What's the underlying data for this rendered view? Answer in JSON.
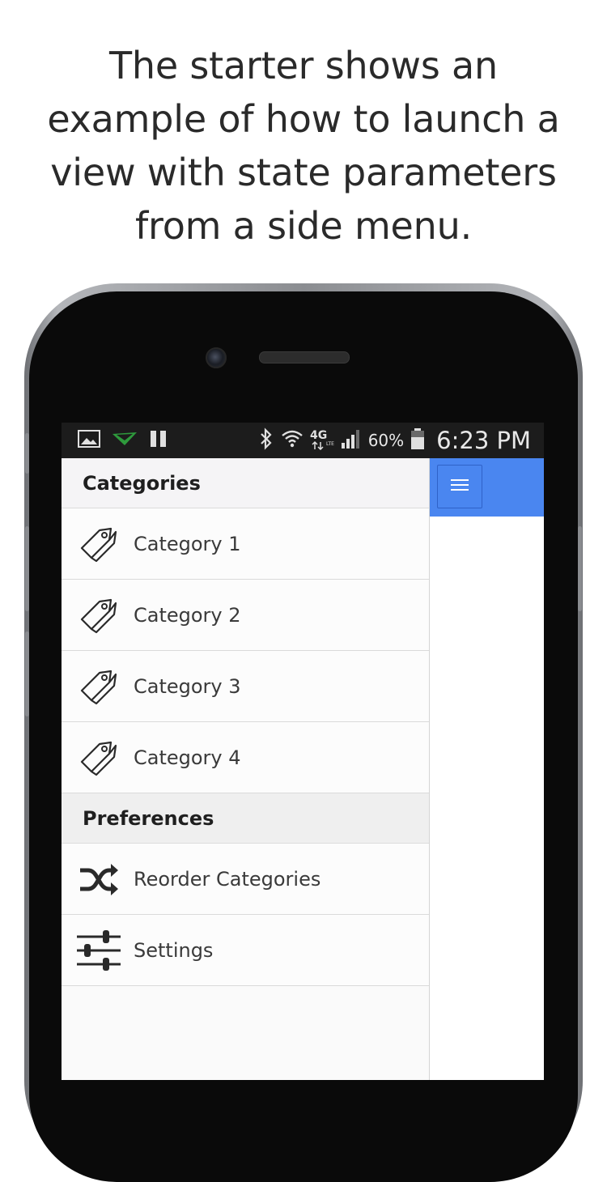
{
  "headline": "The starter shows an example of how to launch a view with state parameters from a side menu.",
  "status_bar": {
    "battery_percent": "60%",
    "time": "6:23 PM",
    "icons": [
      "image-icon",
      "signal-app-icon",
      "pause-icon",
      "bluetooth-icon",
      "wifi-icon",
      "4g-lte-icon",
      "cell-signal-icon",
      "battery-icon"
    ]
  },
  "menu": {
    "sections": [
      {
        "title": "Categories",
        "items": [
          {
            "label": "Category 1",
            "icon": "tag-icon"
          },
          {
            "label": "Category 2",
            "icon": "tag-icon"
          },
          {
            "label": "Category 3",
            "icon": "tag-icon"
          },
          {
            "label": "Category 4",
            "icon": "tag-icon"
          }
        ]
      },
      {
        "title": "Preferences",
        "items": [
          {
            "label": "Reorder Categories",
            "icon": "shuffle-icon"
          },
          {
            "label": "Settings",
            "icon": "sliders-icon"
          }
        ]
      }
    ]
  },
  "main": {
    "header_color": "#4a86f0",
    "toggle_icon": "hamburger-menu-icon"
  }
}
